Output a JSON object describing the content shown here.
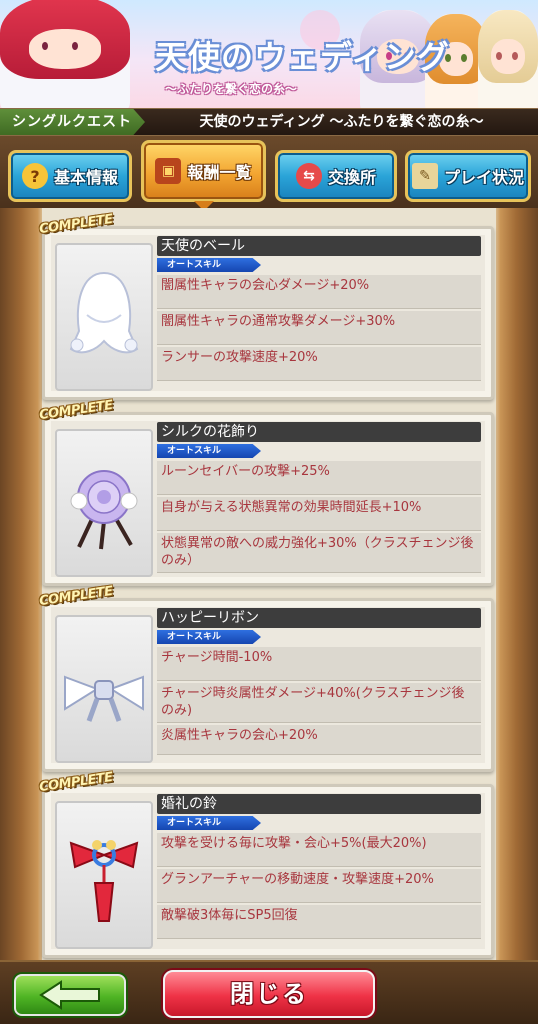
{
  "banner": {
    "title": "天使のウェディング",
    "subtitle": "～ふたりを繋ぐ恋の糸～"
  },
  "quest_bar": {
    "type": "シングルクエスト",
    "name": "天使のウェディング ～ふたりを繋ぐ恋の糸～"
  },
  "tabs": [
    {
      "label": "基本情報",
      "icon": "question-icon"
    },
    {
      "label": "報酬一覧",
      "icon": "treasure-chest-icon"
    },
    {
      "label": "交換所",
      "icon": "exchange-icon"
    },
    {
      "label": "プレイ状況",
      "icon": "scroll-icon"
    }
  ],
  "rewards": [
    {
      "status": "COMPLETE",
      "name": "天使のベール",
      "skill_tag": "オートスキル",
      "icon": "veil-icon",
      "effects": [
        "闇属性キャラの会心ダメージ+20%",
        "闇属性キャラの通常攻撃ダメージ+30%",
        "ランサーの攻撃速度+20%"
      ]
    },
    {
      "status": "COMPLETE",
      "name": "シルクの花飾り",
      "skill_tag": "オートスキル",
      "icon": "flower-ornament-icon",
      "effects": [
        "ルーンセイバーの攻撃+25%",
        "自身が与える状態異常の効果時間延長+10%",
        "状態異常の敵への威力強化+30%（クラスチェンジ後のみ）"
      ]
    },
    {
      "status": "COMPLETE",
      "name": "ハッピーリボン",
      "skill_tag": "オートスキル",
      "icon": "ribbon-icon",
      "effects": [
        "チャージ時間-10%",
        "チャージ時炎属性ダメージ+40%(クラスチェンジ後のみ)",
        "炎属性キャラの会心+20%"
      ]
    },
    {
      "status": "COMPLETE",
      "name": "婚礼の鈴",
      "skill_tag": "オートスキル",
      "icon": "bell-charm-icon",
      "effects": [
        "攻撃を受ける毎に攻撃・会心+5%(最大20%)",
        "グランアーチャーの移動速度・攻撃速度+20%",
        "敵撃破3体毎にSP5回復"
      ]
    }
  ],
  "footer": {
    "back_icon": "left-arrow-icon",
    "close_label": "閉じる"
  }
}
